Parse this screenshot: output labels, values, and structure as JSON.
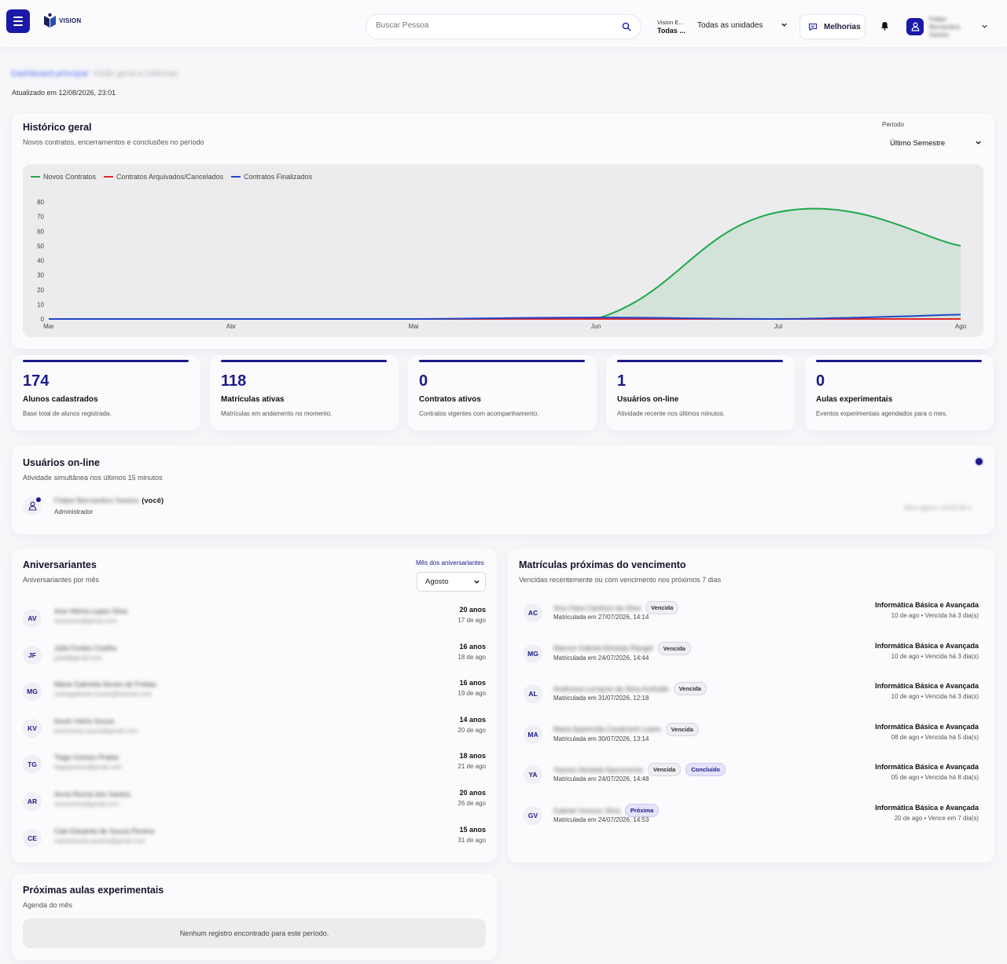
{
  "header": {
    "search_placeholder": "Buscar Pessoa",
    "unit_line1": "Vision E...",
    "unit_line2": "Todas ...",
    "unit_select": "Todas as unidades",
    "improvements_label": "Melhorias",
    "user_name": "Felipe Bernardino Santos",
    "brand": "VISION",
    "colors": {
      "primary": "#1b1aa8",
      "accent": "#1c1a8a"
    }
  },
  "page": {
    "breadcrumb_active": "Dashboard principal",
    "breadcrumb_rest": "Visão geral e métricas",
    "updated": "Atualizado em 12/08/2026, 23:01"
  },
  "history": {
    "title": "Histórico geral",
    "subtitle": "Novos contratos, encerramentos e conclusões no período",
    "period_label": "Período",
    "period_value": "Último Semestre"
  },
  "chart_data": {
    "type": "area",
    "title": "",
    "x": [
      "Mar",
      "Abr",
      "Mai",
      "Jun",
      "Jul",
      "Ago"
    ],
    "yticks": [
      0,
      10,
      20,
      30,
      40,
      50,
      60,
      70,
      80
    ],
    "ylim": [
      0,
      80
    ],
    "grid": false,
    "legend_position": "top-left",
    "series": [
      {
        "name": "Novos Contratos",
        "color": "#1fa84c",
        "values": [
          0,
          0,
          0,
          0,
          73,
          50
        ]
      },
      {
        "name": "Contratos Arquivados/Cancelados",
        "color": "#e0262a",
        "values": [
          0,
          0,
          0,
          0,
          0,
          0
        ]
      },
      {
        "name": "Contratos Finalizados",
        "color": "#2246c8",
        "values": [
          0,
          0,
          0,
          1,
          0,
          3
        ]
      }
    ]
  },
  "stats": [
    {
      "value": "174",
      "label": "Alunos cadastrados",
      "desc": "Base total de alunos registrada."
    },
    {
      "value": "118",
      "label": "Matrículas ativas",
      "desc": "Matrículas em andamento no momento."
    },
    {
      "value": "0",
      "label": "Contratos ativos",
      "desc": "Contratos vigentes com acompanhamento."
    },
    {
      "value": "1",
      "label": "Usuários on-line",
      "desc": "Atividade recente nos últimos minutos."
    },
    {
      "value": "0",
      "label": "Aulas experimentais",
      "desc": "Eventos experimentais agendados para o mes."
    }
  ],
  "online": {
    "title": "Usuários on-line",
    "subtitle": "Atividade simultânea nos últimos 15 minutos",
    "user_name": "Felipe Bernardino Santos",
    "you": "(você)",
    "role": "Administrador",
    "time": "Ativo agora • 23:01:05 h"
  },
  "birthdays": {
    "title": "Aniversariantes",
    "subtitle": "Aniversariantes por mês",
    "month_label": "Mês dos aniversariantes",
    "month_value": "Agosto",
    "items": [
      {
        "initials": "AV",
        "name": "Ana Vitória Lopes Silva",
        "email": "anavitoria@gmail.com",
        "age": "20 anos",
        "day": "17 de ago"
      },
      {
        "initials": "JF",
        "name": "Júlia Fontes Coelho",
        "email": "juliaf@gmail.com",
        "age": "16 anos",
        "day": "18 de ago"
      },
      {
        "initials": "MG",
        "name": "Maria Gabriela Nunes de Freitas",
        "email": "mariagabriela.nunes@hotmail.com",
        "age": "16 anos",
        "day": "19 de ago"
      },
      {
        "initials": "KV",
        "name": "Kevin Vieira Souza",
        "email": "kevinvieira.souza@gmail.com",
        "age": "14 anos",
        "day": "20 de ago"
      },
      {
        "initials": "TG",
        "name": "Tiago Gomes Prates",
        "email": "tiagogomes@gmail.com",
        "age": "18 anos",
        "day": "21 de ago"
      },
      {
        "initials": "AR",
        "name": "Anna Rocha dos Santos",
        "email": "annarocha@gmail.com",
        "age": "20 anos",
        "day": "26 de ago"
      },
      {
        "initials": "CE",
        "name": "Caio Eduardo de Souza Pereira",
        "email": "caioeduardo.pereira@gmail.com",
        "age": "15 anos",
        "day": "31 de ago"
      }
    ]
  },
  "enrollments": {
    "title": "Matrículas próximas do vencimento",
    "subtitle": "Vencidas recentemente ou com vencimento nos próximos 7 dias",
    "items": [
      {
        "initials": "AC",
        "name": "Ana Clara Cardoso da Silva",
        "badges": [
          {
            "text": "Vencida",
            "style": "gray"
          }
        ],
        "date": "Matriculada em 27/07/2026, 14:14",
        "course": "Informática Básica e Avançada",
        "due": "10 de ago • Vencida há 3 dia(s)"
      },
      {
        "initials": "MG",
        "name": "Marcos Gabriel Almeida Rangel",
        "badges": [
          {
            "text": "Vencida",
            "style": "gray"
          }
        ],
        "date": "Matriculada em 24/07/2026, 14:44",
        "course": "Informática Básica e Avançada",
        "due": "10 de ago • Vencida há 3 dia(s)"
      },
      {
        "initials": "AL",
        "name": "Andressa Lorrayne da Silva Andrade",
        "badges": [
          {
            "text": "Vencida",
            "style": "gray"
          }
        ],
        "date": "Matriculada em 31/07/2026, 12:18",
        "course": "Informática Básica e Avançada",
        "due": "10 de ago • Vencida há 3 dia(s)"
      },
      {
        "initials": "MA",
        "name": "Maria Aparecida Cavalcanti Lopes",
        "badges": [
          {
            "text": "Vencida",
            "style": "gray"
          }
        ],
        "date": "Matriculada em 30/07/2026, 13:14",
        "course": "Informática Básica e Avançada",
        "due": "08 de ago • Vencida há 5 dia(s)"
      },
      {
        "initials": "YA",
        "name": "Yasmin Almeida Nascimento",
        "badges": [
          {
            "text": "Vencida",
            "style": "gray"
          },
          {
            "text": "Concluído",
            "style": "blue"
          }
        ],
        "date": "Matriculada em 24/07/2026, 14:48",
        "course": "Informática Básica e Avançada",
        "due": "05 de ago • Vencida há 8 dia(s)"
      },
      {
        "initials": "GV",
        "name": "Gabriel Vinícius Silva",
        "badges": [
          {
            "text": "Próxima",
            "style": "blue"
          }
        ],
        "date": "Matriculada em 24/07/2026, 14:53",
        "course": "Informática Básica e Avançada",
        "due": "20 de ago • Vence em 7 dia(s)"
      }
    ]
  },
  "trials": {
    "title": "Próximas aulas experimentais",
    "subtitle": "Agenda do mês",
    "empty": "Nenhum registro encontrado para este período."
  }
}
